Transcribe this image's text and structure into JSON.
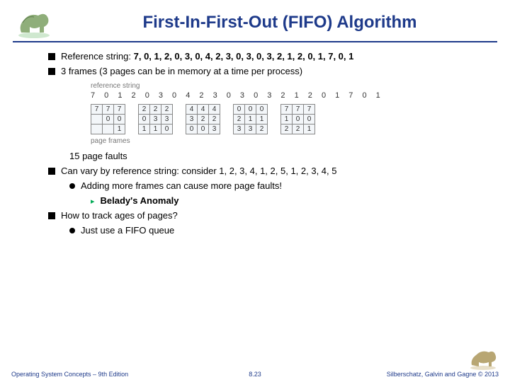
{
  "header": {
    "title": "First-In-First-Out (FIFO) Algorithm"
  },
  "bullets": {
    "b1_prefix": "Reference string: ",
    "b1_bold": "7, 0, 1, 2, 0, 3, 0, 4, 2, 3, 0, 3, 0, 3, 2, 1, 2, 0, 1, 7, 0, 1",
    "b2": "3 frames (3 pages can be in memory at a time per process)",
    "faults": "15 page faults",
    "b3": "Can vary by reference string: consider 1, 2, 3, 4, 1, 2, 5, 1, 2, 3, 4, 5",
    "b3a": "Adding more frames can cause more page faults!",
    "b3a1": "Belady's Anomaly",
    "b4": "How to track ages of pages?",
    "b4a": "Just use a FIFO queue"
  },
  "figure": {
    "ref_label": "reference string",
    "ref_nums": "7 0 1 2 0 3 0 4 2 3 0 3 0 3 2 1 2 0 1 7 0 1",
    "pf_label": "page frames",
    "groups": [
      [
        [
          "7",
          "7",
          "7"
        ],
        [
          "",
          "0",
          "0"
        ],
        [
          "",
          "",
          "1"
        ]
      ],
      [
        [
          "2",
          "2",
          "2"
        ],
        [
          "0",
          "3",
          "3"
        ],
        [
          "1",
          "1",
          "0"
        ]
      ],
      [
        [
          "4",
          "4",
          "4"
        ],
        [
          "3",
          "2",
          "2"
        ],
        [
          "0",
          "0",
          "3"
        ]
      ],
      [
        [
          "0",
          "0",
          "0"
        ],
        [
          "2",
          "1",
          "1"
        ],
        [
          "3",
          "3",
          "2"
        ]
      ],
      [
        [
          "7",
          "7",
          "7"
        ],
        [
          "1",
          "0",
          "0"
        ],
        [
          "2",
          "2",
          "1"
        ]
      ]
    ]
  },
  "footer": {
    "left": "Operating System Concepts – 9th Edition",
    "mid": "8.23",
    "right": "Silberschatz, Galvin and Gagne © 2013"
  }
}
